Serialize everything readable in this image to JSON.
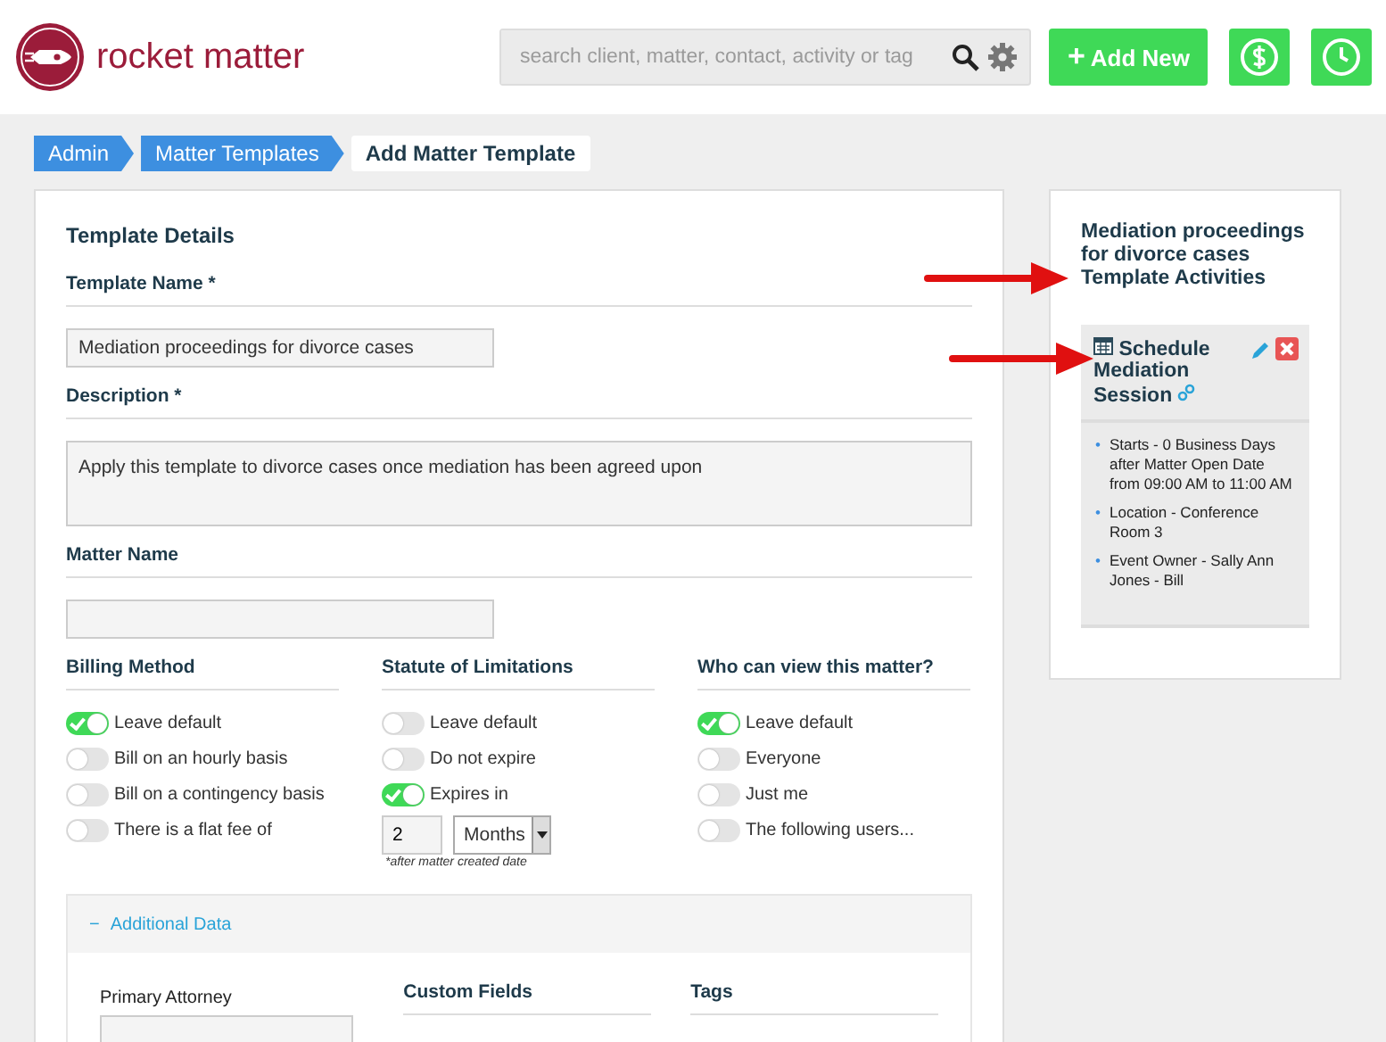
{
  "header": {
    "logo_text": "rocket matter",
    "search": {
      "placeholder": "search client, matter, contact, activity or tag"
    },
    "add_button": {
      "icon": "+",
      "label": "Add New"
    }
  },
  "breadcrumb": [
    {
      "label": "Admin",
      "selected": false
    },
    {
      "label": "Matter Templates",
      "selected": false
    },
    {
      "label": "Add Matter Template",
      "selected": true
    }
  ],
  "form": {
    "title": "Template Details",
    "template_name": {
      "label": "Template Name *",
      "value": "Mediation proceedings for divorce cases"
    },
    "description": {
      "label": "Description *",
      "value": "Apply this template to divorce cases once mediation has been agreed upon"
    },
    "matter_name": {
      "label": "Matter Name"
    },
    "groups": [
      {
        "title": "Billing Method",
        "options": [
          {
            "label": "Leave default",
            "on": true
          },
          {
            "label": "Bill on an hourly basis",
            "on": false
          },
          {
            "label": "Bill on a contingency basis",
            "on": false
          },
          {
            "label": "There is a flat fee of",
            "on": false
          }
        ]
      },
      {
        "title": "Statute of Limitations",
        "options": [
          {
            "label": "Leave default",
            "on": false
          },
          {
            "label": "Do not expire",
            "on": false
          },
          {
            "label": "Expires in",
            "on": true
          }
        ],
        "expiry": {
          "value": "2",
          "unit": "Months",
          "note": "*after matter created date"
        }
      },
      {
        "title": "Who can view this matter?",
        "options": [
          {
            "label": "Leave default",
            "on": true
          },
          {
            "label": "Everyone",
            "on": false
          },
          {
            "label": "Just me",
            "on": false
          },
          {
            "label": "The following users...",
            "on": false
          }
        ]
      }
    ],
    "additional": {
      "toggle": "−",
      "title": "Additional Data",
      "expanded": true,
      "primary_attorney": "Primary Attorney",
      "custom_fields": "Custom Fields",
      "tags": "Tags"
    }
  },
  "activities": {
    "title": "Mediation proceedings for divorce cases Template Activities",
    "items": [
      {
        "title": "Schedule Mediation Session",
        "bullet": "•",
        "details": [
          "Starts - 0 Business Days after Matter Open Date from 09:00 AM to 11:00 AM",
          "Location - Conference Room 3",
          "Event Owner - Sally Ann Jones - Bill"
        ]
      }
    ]
  },
  "annotations": [
    {
      "kind": "arrow"
    },
    {
      "kind": "arrow"
    }
  ]
}
